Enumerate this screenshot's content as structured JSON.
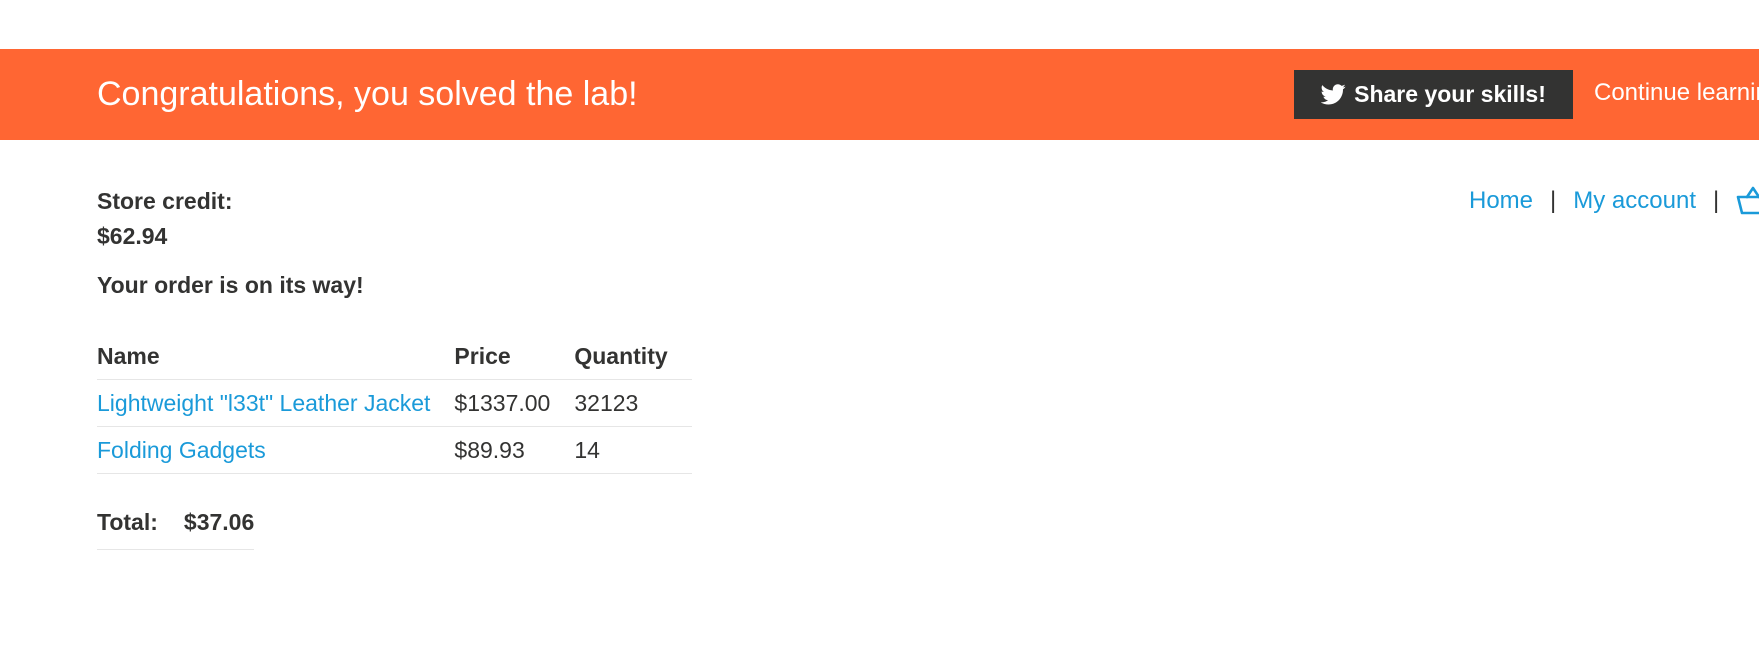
{
  "banner": {
    "title": "Congratulations, you solved the lab!",
    "share_label": "Share your skills!",
    "share_icon": "twitter-icon",
    "continue_label": "Continue learning",
    "background_color": "#ff6633"
  },
  "account": {
    "credit_label": "Store credit:",
    "credit_value": "$62.94"
  },
  "nav": {
    "home_label": "Home",
    "separator": "|",
    "account_label": "My account",
    "cart_icon": "cart-basket-icon"
  },
  "order": {
    "message": "Your order is on its way!",
    "columns": [
      "Name",
      "Price",
      "Quantity"
    ],
    "rows": [
      {
        "name": "Lightweight \"l33t\" Leather Jacket",
        "price": "$1337.00",
        "quantity": "32123"
      },
      {
        "name": "Folding Gadgets",
        "price": "$89.93",
        "quantity": "14"
      }
    ],
    "total_label": "Total:",
    "total_value": "$37.06"
  },
  "colors": {
    "link": "#1a9ad9",
    "text": "#333332",
    "banner": "#ff6633",
    "share_button": "#333332"
  }
}
